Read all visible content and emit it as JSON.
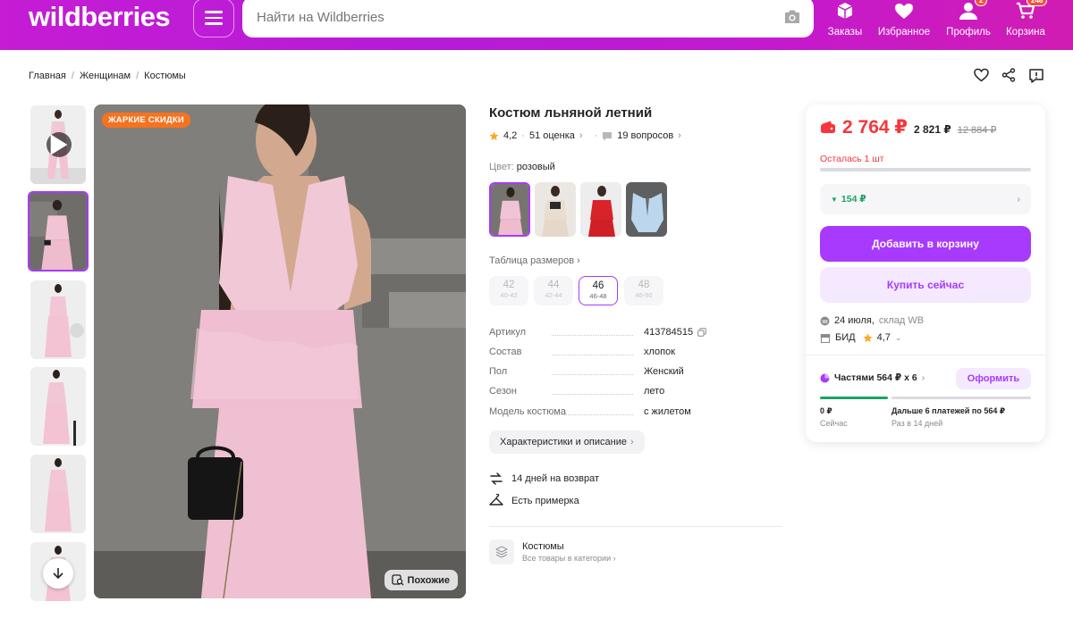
{
  "header": {
    "logo": "wildberries",
    "search_placeholder": "Найти на Wildberries",
    "nav": [
      {
        "label": "Заказы",
        "icon": "box-icon"
      },
      {
        "label": "Избранное",
        "icon": "heart-icon"
      },
      {
        "label": "Профиль",
        "icon": "user-icon",
        "badge": "2"
      },
      {
        "label": "Корзина",
        "icon": "cart-icon",
        "badge": "248"
      }
    ]
  },
  "breadcrumbs": [
    "Главная",
    "Женщинам",
    "Костюмы"
  ],
  "gallery": {
    "badge": "ЖАРКИЕ СКИДКИ",
    "similar_label": "Похожие"
  },
  "product": {
    "title": "Костюм льняной летний",
    "rating": "4,2",
    "reviews": "51 оценка",
    "questions": "19 вопросов",
    "color_label": "Цвет:",
    "color_value": "розовый",
    "size_table_label": "Таблица размеров",
    "sizes": [
      {
        "num": "42",
        "range": "40-42"
      },
      {
        "num": "44",
        "range": "42-44"
      },
      {
        "num": "46",
        "range": "46-48"
      },
      {
        "num": "48",
        "range": "46-50"
      }
    ],
    "specs": [
      {
        "k": "Артикул",
        "v": "413784515"
      },
      {
        "k": "Состав",
        "v": "хлопок"
      },
      {
        "k": "Пол",
        "v": "Женский"
      },
      {
        "k": "Сезон",
        "v": "лето"
      },
      {
        "k": "Модель костюма",
        "v": "с жилетом"
      }
    ],
    "chars_button": "Характеристики и описание",
    "features": [
      "14 дней на возврат",
      "Есть примерка"
    ],
    "category_title": "Костюмы",
    "category_link": "Все товары в категории"
  },
  "buy_box": {
    "price": "2 764 ₽",
    "price_wallet": "2 821 ₽",
    "price_old": "12 884 ₽",
    "stock_left": "Осталась 1 шт",
    "cashback": "154 ₽",
    "add_to_cart": "Добавить в корзину",
    "buy_now": "Купить сейчас",
    "delivery": "24 июля,",
    "warehouse": "склад WB",
    "seller": "БИД",
    "seller_rating": "4,7",
    "installments": "Частями 564 ₽ x 6",
    "installments_button": "Оформить",
    "pay_now_amount": "0 ₽",
    "pay_now_label": "Сейчас",
    "pay_later_text": "Дальше 6 платежей по 564 ₽",
    "pay_later_label": "Раз в 14 дней"
  },
  "colors": {
    "accent": "#a73afd",
    "price_red": "#f5363d",
    "header_gradient_start": "#c51cd4",
    "header_gradient_end": "#d11cb3",
    "cashback_green": "#19a463",
    "hot_orange": "#f5721f"
  }
}
